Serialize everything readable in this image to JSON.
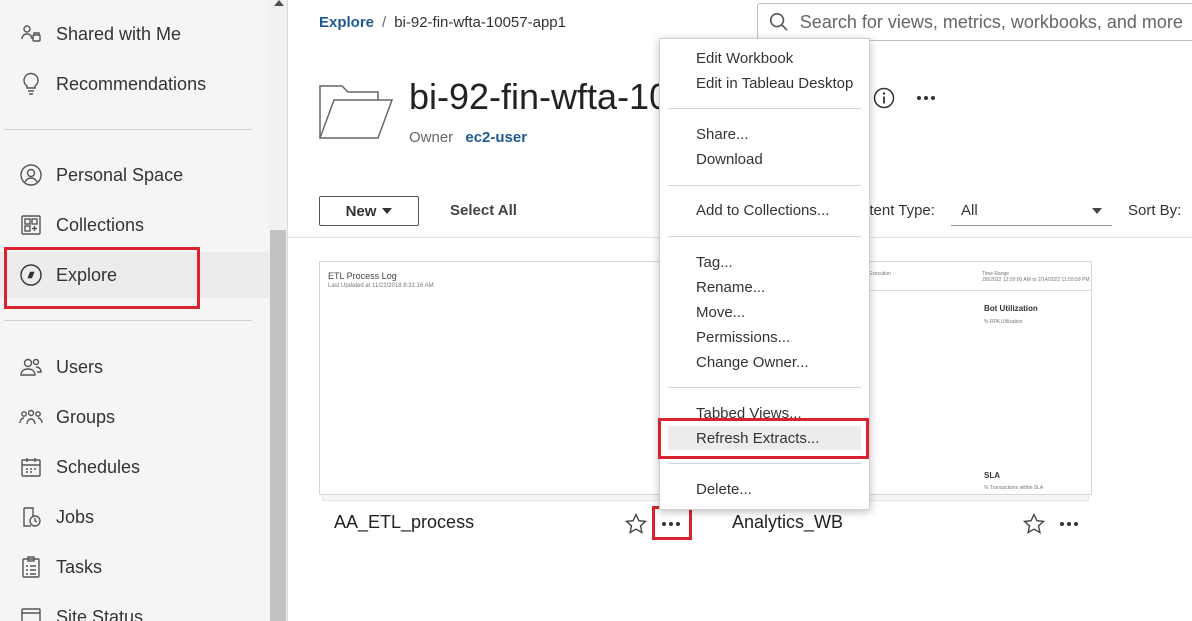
{
  "sidebar": {
    "items": [
      {
        "label": "Shared with Me",
        "icon": "shared-with-me-icon"
      },
      {
        "label": "Recommendations",
        "icon": "lightbulb-icon"
      },
      {
        "label": "Personal Space",
        "icon": "person-icon"
      },
      {
        "label": "Collections",
        "icon": "collections-icon"
      },
      {
        "label": "Explore",
        "icon": "compass-icon"
      },
      {
        "label": "Users",
        "icon": "users-icon"
      },
      {
        "label": "Groups",
        "icon": "groups-icon"
      },
      {
        "label": "Schedules",
        "icon": "calendar-icon"
      },
      {
        "label": "Jobs",
        "icon": "jobs-icon"
      },
      {
        "label": "Tasks",
        "icon": "clipboard-icon"
      },
      {
        "label": "Site Status",
        "icon": "site-status-icon"
      }
    ],
    "active": "Explore"
  },
  "breadcrumb": {
    "root": "Explore",
    "separator": "/",
    "current": "bi-92-fin-wfta-10057-app1"
  },
  "search": {
    "placeholder": "Search for views, metrics, workbooks, and more"
  },
  "project": {
    "title": "bi-92-fin-wfta-10057-app1",
    "owner_label": "Owner",
    "owner_name": "ec2-user"
  },
  "toolbar": {
    "new_label": "New",
    "select_all_label": "Select All",
    "content_type_label": "ntent Type:",
    "content_type_value": "All",
    "sort_by_label": "Sort By:"
  },
  "cards": [
    {
      "name": "AA_ETL_process",
      "thumb_title": "ETL Process Log",
      "thumb_subtitle": "Last Updated at 11/21/2018 8:31:16 AM"
    },
    {
      "name": "Analytics_WB",
      "thumb_header_left": "Execution",
      "thumb_header_right": "Time Range",
      "thumb_range": "2/8/2022 12:00:00 AM to 2/14/2022 11:59:59 PM",
      "thumb_section1": "Bot Utilization",
      "thumb_section1_sub": "% RPA Utilization",
      "thumb_section2": "SLA",
      "thumb_section2_sub": "% Transactions within SLA"
    }
  ],
  "context_menu": {
    "items": [
      "Edit Workbook",
      "Edit in Tableau Desktop",
      "Share...",
      "Download",
      "Add to Collections...",
      "Tag...",
      "Rename...",
      "Move...",
      "Permissions...",
      "Change Owner...",
      "Tabbed Views...",
      "Refresh Extracts...",
      "Delete..."
    ],
    "highlighted": "Refresh Extracts..."
  },
  "colors": {
    "link": "#1f5a96",
    "highlight_box": "#d9232f",
    "sidebar_bg": "#f5f5f5"
  }
}
